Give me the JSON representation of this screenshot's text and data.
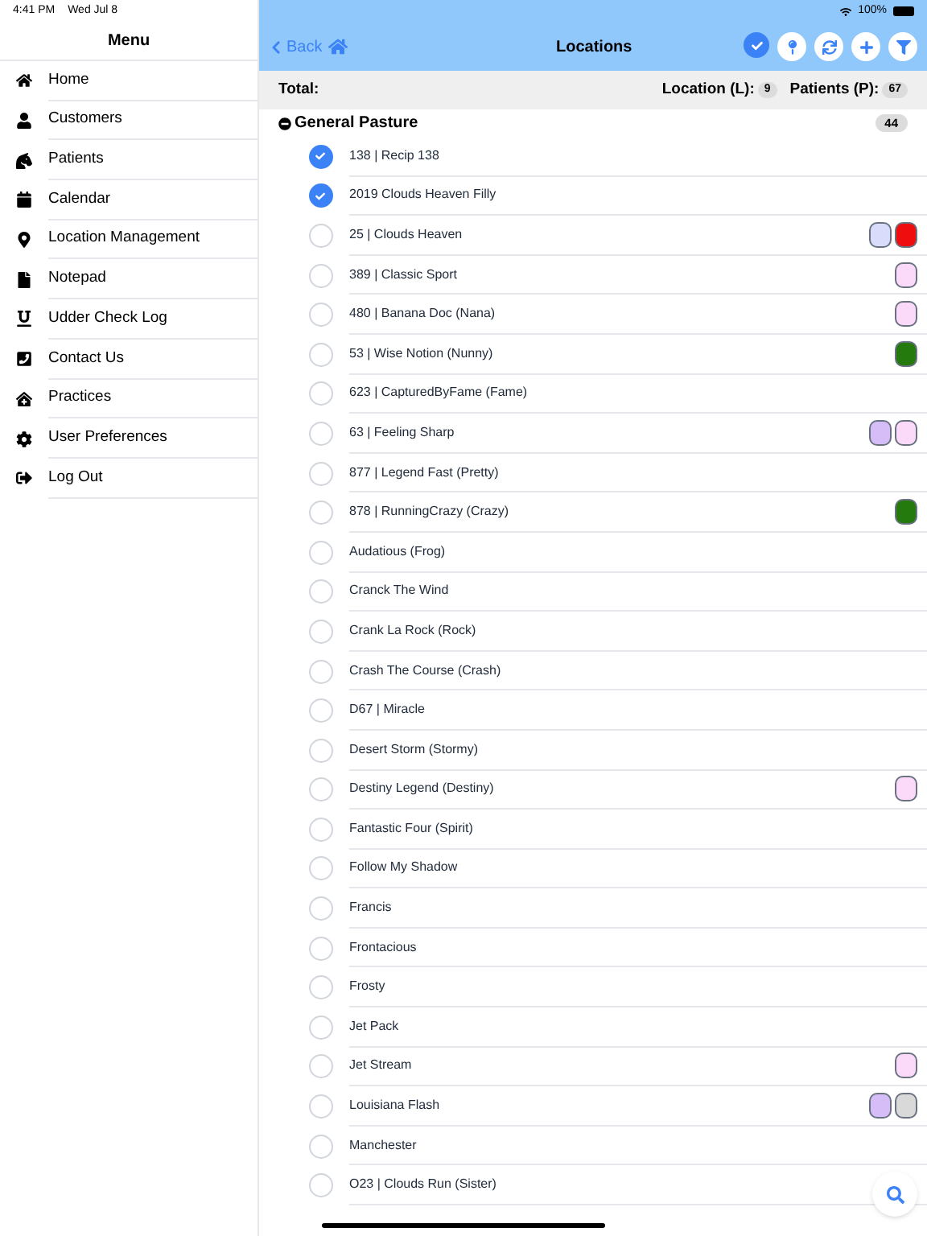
{
  "status_bar": {
    "time": "4:41 PM",
    "date": "Wed Jul 8",
    "battery": "100%"
  },
  "sidebar": {
    "title": "Menu",
    "items": [
      {
        "label": "Home",
        "kind": "home"
      },
      {
        "label": "Customers",
        "kind": "user"
      },
      {
        "label": "Patients",
        "kind": "horse"
      },
      {
        "label": "Calendar",
        "kind": "calendar"
      },
      {
        "label": "Location Management",
        "kind": "pin"
      },
      {
        "label": "Notepad",
        "kind": "file"
      },
      {
        "label": "Udder Check Log",
        "kind": "underline"
      },
      {
        "label": "Contact Us",
        "kind": "phone"
      },
      {
        "label": "Practices",
        "kind": "clinic"
      },
      {
        "label": "User Preferences",
        "kind": "gear"
      },
      {
        "label": "Log Out",
        "kind": "logout"
      }
    ]
  },
  "nav": {
    "back": "Back",
    "title": "Locations"
  },
  "totals": {
    "label": "Total:",
    "location_label": "Location (L):",
    "location_count": "9",
    "patients_label": "Patients (P):",
    "patients_count": "67"
  },
  "group": {
    "name": "General Pasture",
    "count": "44",
    "expanded": true,
    "rows": [
      {
        "label": "138 | Recip 138",
        "selected": true,
        "tags": []
      },
      {
        "label": "2019 Clouds Heaven Filly",
        "selected": true,
        "tags": []
      },
      {
        "label": "25 | Clouds Heaven",
        "selected": false,
        "tags": [
          {
            "color": "#d9dcfb"
          },
          {
            "color": "#f00d0d"
          }
        ]
      },
      {
        "label": "389 | Classic Sport",
        "selected": false,
        "tags": [
          {
            "color": "#fbd9f8"
          }
        ]
      },
      {
        "label": "480 | Banana Doc (Nana)",
        "selected": false,
        "tags": [
          {
            "color": "#fbd9f8"
          }
        ]
      },
      {
        "label": "53 | Wise Notion (Nunny)",
        "selected": false,
        "tags": [
          {
            "color": "#247a0d"
          }
        ]
      },
      {
        "label": "623 | CapturedByFame (Fame)",
        "selected": false,
        "tags": []
      },
      {
        "label": "63 | Feeling Sharp",
        "selected": false,
        "tags": [
          {
            "color": "#d6bdf7"
          },
          {
            "color": "#fbd9f8"
          }
        ]
      },
      {
        "label": "877 | Legend Fast (Pretty)",
        "selected": false,
        "tags": []
      },
      {
        "label": "878 | RunningCrazy (Crazy)",
        "selected": false,
        "tags": [
          {
            "color": "#247a0d"
          }
        ]
      },
      {
        "label": "Audatious (Frog)",
        "selected": false,
        "tags": []
      },
      {
        "label": "Cranck The Wind",
        "selected": false,
        "tags": []
      },
      {
        "label": "Crank La Rock (Rock)",
        "selected": false,
        "tags": []
      },
      {
        "label": "Crash The Course (Crash)",
        "selected": false,
        "tags": []
      },
      {
        "label": "D67 | Miracle",
        "selected": false,
        "tags": []
      },
      {
        "label": "Desert Storm (Stormy)",
        "selected": false,
        "tags": []
      },
      {
        "label": "Destiny Legend (Destiny)",
        "selected": false,
        "tags": [
          {
            "color": "#fbd9f8"
          }
        ]
      },
      {
        "label": "Fantastic Four (Spirit)",
        "selected": false,
        "tags": []
      },
      {
        "label": "Follow My Shadow",
        "selected": false,
        "tags": []
      },
      {
        "label": "Francis",
        "selected": false,
        "tags": []
      },
      {
        "label": "Frontacious",
        "selected": false,
        "tags": []
      },
      {
        "label": "Frosty",
        "selected": false,
        "tags": []
      },
      {
        "label": "Jet Pack",
        "selected": false,
        "tags": []
      },
      {
        "label": "Jet Stream",
        "selected": false,
        "tags": [
          {
            "color": "#fbd9f8"
          }
        ]
      },
      {
        "label": "Louisiana Flash",
        "selected": false,
        "tags": [
          {
            "color": "#d6bdf7"
          },
          {
            "color": "#d9d9d9"
          }
        ]
      },
      {
        "label": "Manchester",
        "selected": false,
        "tags": []
      },
      {
        "label": "O23 | Clouds Run (Sister)",
        "selected": false,
        "tags": []
      }
    ]
  }
}
